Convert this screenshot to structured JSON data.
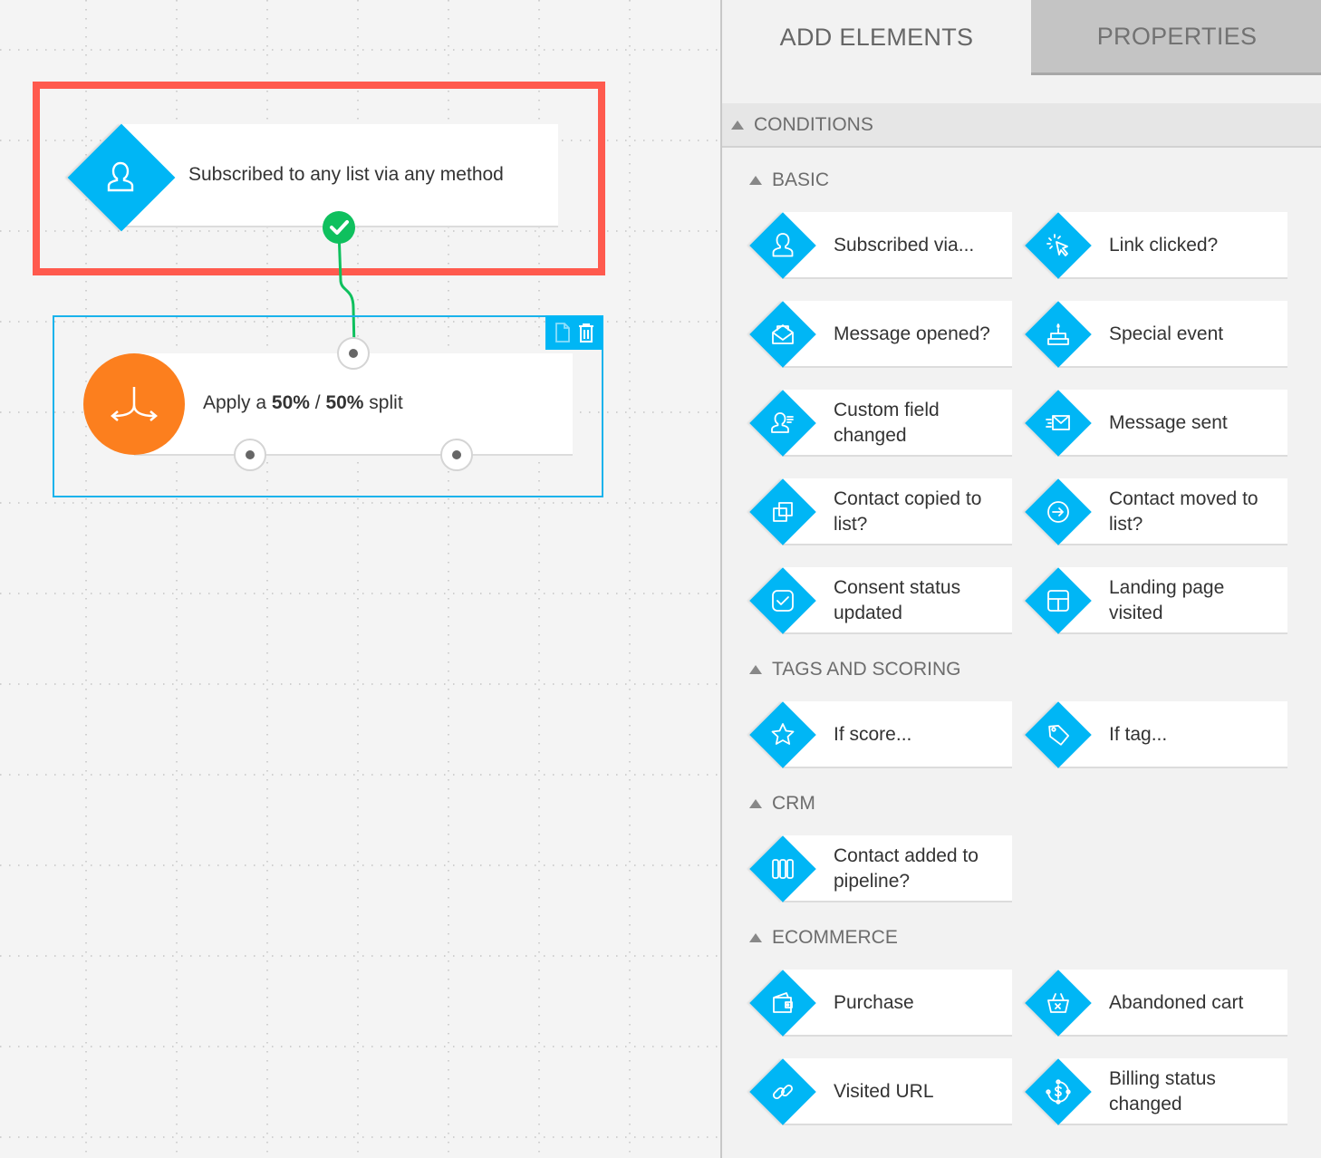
{
  "canvas": {
    "trigger_node": {
      "label": "Subscribed to any list via any method",
      "icon": "user-icon",
      "status_icon": "check-icon",
      "highlight_color": "#ff5a4e"
    },
    "split_node": {
      "label_prefix": "Apply a ",
      "percent_a": "50%",
      "separator": " / ",
      "percent_b": "50%",
      "label_suffix": " split",
      "icon": "split-arrows-icon",
      "toolbar": {
        "copy_icon": "copy-icon",
        "delete_icon": "trash-icon"
      },
      "accent_color": "#fc7f1e",
      "selection_color": "#19b3ec"
    },
    "connector_color": "#0fc05e"
  },
  "panel": {
    "tabs": [
      {
        "label": "ADD ELEMENTS",
        "active": true
      },
      {
        "label": "PROPERTIES",
        "active": false
      }
    ],
    "section": {
      "label": "CONDITIONS"
    },
    "groups": [
      {
        "label": "BASIC",
        "items": [
          {
            "label": "Subscribed via...",
            "icon": "user-icon"
          },
          {
            "label": "Link clicked?",
            "icon": "cursor-click-icon"
          },
          {
            "label": "Message opened?",
            "icon": "open-envelope-icon"
          },
          {
            "label": "Special event",
            "icon": "cake-icon"
          },
          {
            "label": "Custom field changed",
            "icon": "user-fields-icon"
          },
          {
            "label": "Message sent",
            "icon": "envelope-send-icon"
          },
          {
            "label": "Contact copied to list?",
            "icon": "copy-squares-icon"
          },
          {
            "label": "Contact moved to list?",
            "icon": "arrow-circle-icon"
          },
          {
            "label": "Consent status updated",
            "icon": "checkbox-icon"
          },
          {
            "label": "Landing page visited",
            "icon": "layout-icon"
          }
        ]
      },
      {
        "label": "TAGS AND SCORING",
        "items": [
          {
            "label": "If score...",
            "icon": "star-icon"
          },
          {
            "label": "If tag...",
            "icon": "tag-icon"
          }
        ]
      },
      {
        "label": "CRM",
        "items": [
          {
            "label": "Contact added to pipeline?",
            "icon": "pipeline-icon"
          }
        ]
      },
      {
        "label": "ECOMMERCE",
        "items": [
          {
            "label": "Purchase",
            "icon": "wallet-icon"
          },
          {
            "label": "Abandoned cart",
            "icon": "basket-icon"
          },
          {
            "label": "Visited URL",
            "icon": "link-icon"
          },
          {
            "label": "Billing status changed",
            "icon": "billing-cycle-icon"
          }
        ]
      }
    ],
    "accent_color": "#00b6f5"
  }
}
